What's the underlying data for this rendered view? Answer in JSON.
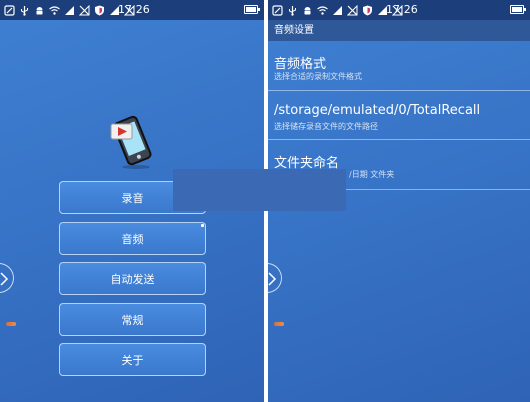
{
  "status_bar": {
    "time": "17:26",
    "icons": [
      "notification-icon",
      "usb-icon",
      "android-icon",
      "wifi-icon",
      "signal-icon",
      "no-sim-icon",
      "shield-icon",
      "signal-icon",
      "no-sim-icon"
    ]
  },
  "main_menu": {
    "buttons": [
      {
        "label": "录音"
      },
      {
        "label": "音频"
      },
      {
        "label": "自动发送"
      },
      {
        "label": "常规"
      },
      {
        "label": "关于"
      }
    ]
  },
  "audio_settings": {
    "header": "音频设置",
    "items": [
      {
        "title": "音频格式",
        "subtitle": "选择合适的录制文件格式"
      },
      {
        "title": "/storage/emulated/0/TotalRecall",
        "subtitle": "选择储存录音文件的文件路径"
      },
      {
        "title": "文件夹命名",
        "subtitle": "/日期 文件夹"
      }
    ]
  },
  "colors": {
    "background": "#3671c4",
    "status_bar": "#1c3f7c",
    "header": "#2f5898",
    "overlay": "#3b69b4"
  }
}
